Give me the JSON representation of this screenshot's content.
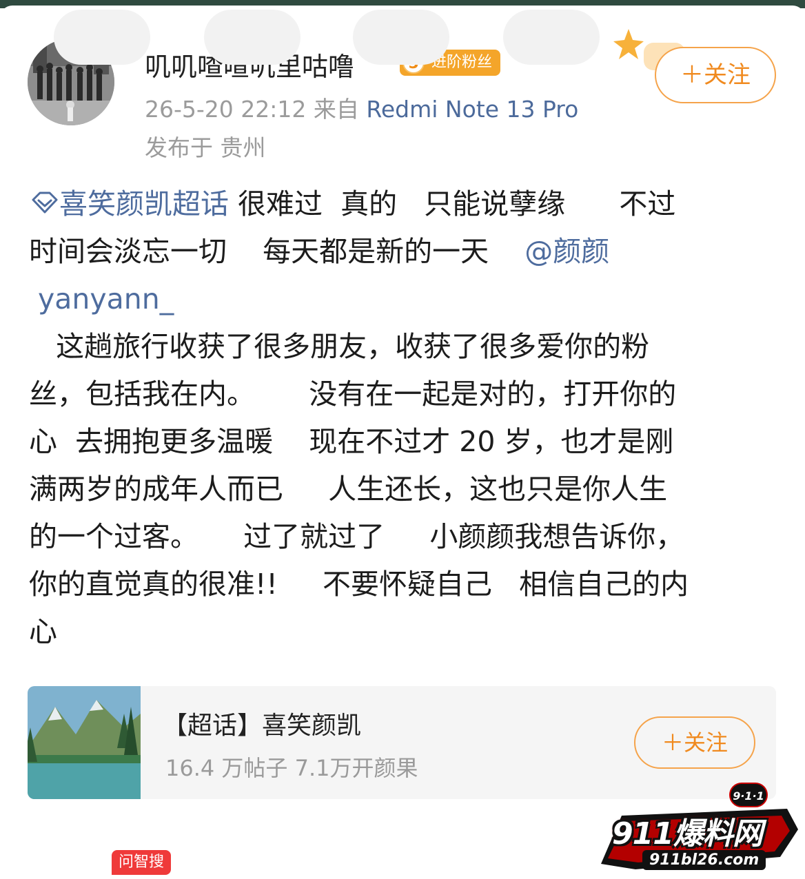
{
  "user": {
    "name": "叽叽喳喳叽里咕噜",
    "fan_badge": {
      "level": "5",
      "label": "进阶粉丝"
    },
    "timestamp": "26-5-20 22:12",
    "source_prefix": "来自",
    "device": "Redmi Note 13 Pro",
    "location": "发布于 贵州",
    "follow_label": "＋关注"
  },
  "post": {
    "topic": "喜笑颜凯超话",
    "line1_rest": " 很难过  真的   只能说孽缘      不过",
    "line2_text": "时间会淡忘一切    每天都是新的一天    ",
    "mention_part1": "@颜颜",
    "mention_part2": " yanyann_",
    "lines": [
      "   这趟旅行收获了很多朋友，收获了很多爱你的粉",
      "丝，包括我在内。      没有在一起是对的，打开你的",
      "心  去拥抱更多温暖    现在不过才 20 岁，也才是刚",
      "满两岁的成年人而已     人生还长，这也只是你人生",
      "的一个过客。     过了就过了     小颜颜我想告诉你，",
      "你的直觉真的很准!!     不要怀疑自己   相信自己的内",
      "心"
    ]
  },
  "card": {
    "title": "【超话】喜笑颜凯",
    "stats": "16.4 万帖子 7.1万开颜果",
    "follow_label": "＋关注"
  },
  "bottom": {
    "wenzhisou": "问智搜"
  },
  "watermark": {
    "tag": "9·1·1",
    "main": "911爆料网",
    "url": "911bl26.com"
  },
  "colors": {
    "accent_orange": "#f08a1f",
    "link_blue": "#4e6c9e",
    "badge_orange": "#f4a52a"
  }
}
